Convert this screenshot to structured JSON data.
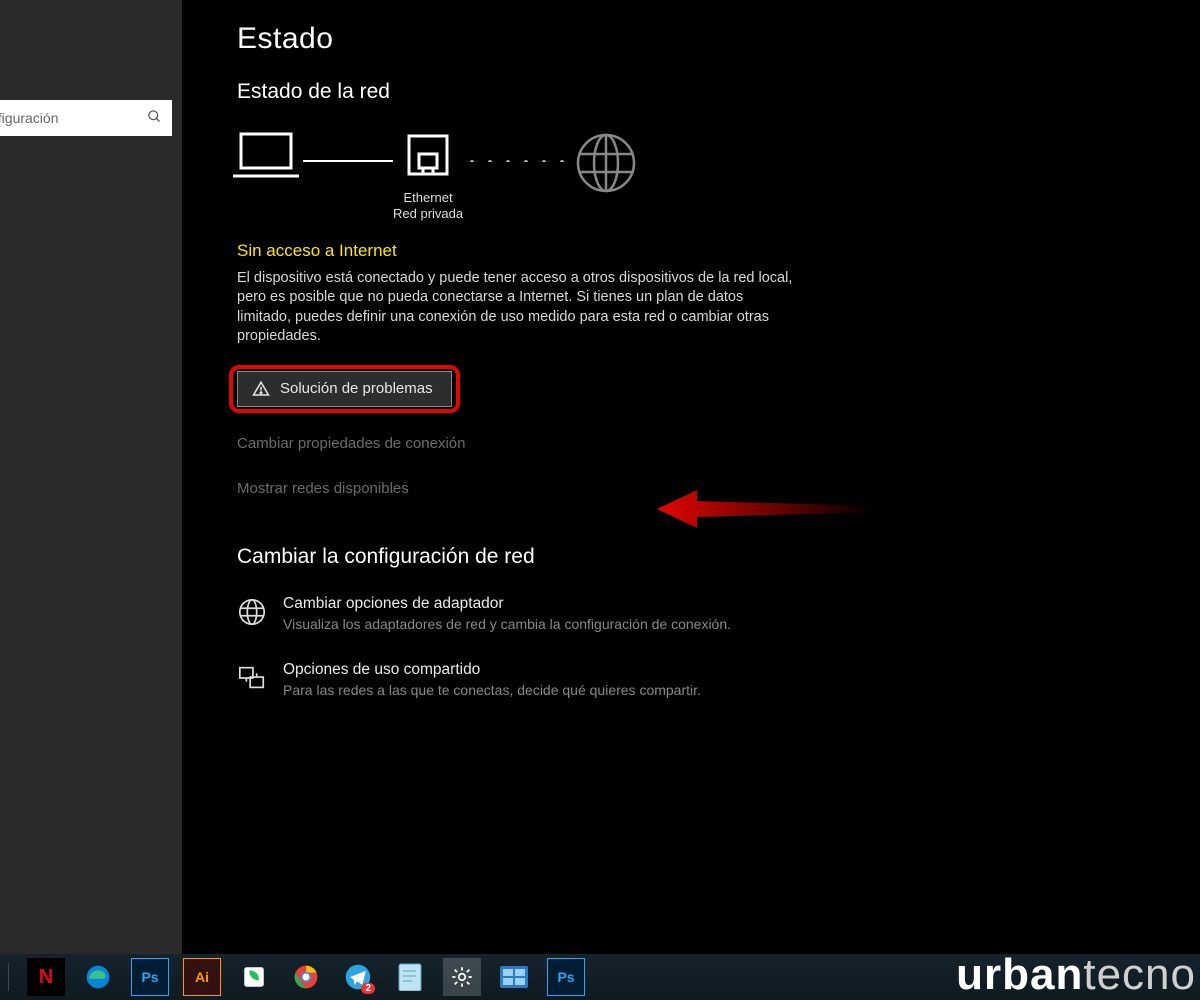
{
  "search": {
    "placeholder": "nfiguración"
  },
  "page": {
    "title": "Estado",
    "network_status_heading": "Estado de la red",
    "ethernet_label": "Ethernet",
    "ethernet_sub": "Red privada",
    "warn_title": "Sin acceso a Internet",
    "warn_text": "El dispositivo está conectado y puede tener acceso a otros dispositivos de la red local, pero es posible que no pueda conectarse a Internet. Si tienes un plan de datos limitado, puedes definir una conexión de uso medido para esta red o cambiar otras propiedades.",
    "troubleshoot_btn": "Solución de problemas",
    "link_change_props": "Cambiar propiedades de conexión",
    "link_show_networks": "Mostrar redes disponibles",
    "change_settings_heading": "Cambiar la configuración de red",
    "options": [
      {
        "title": "Cambiar opciones de adaptador",
        "desc": "Visualiza los adaptadores de red y cambia la configuración de conexión."
      },
      {
        "title": "Opciones de uso compartido",
        "desc": "Para las redes a las que te conectas, decide qué quieres compartir."
      }
    ]
  },
  "taskbar": {
    "icons": [
      "netflix",
      "edge",
      "photoshop",
      "illustrator",
      "evernote",
      "chrome",
      "telegram",
      "notepad",
      "settings",
      "control-panel",
      "photoshop"
    ]
  },
  "watermark": {
    "bold": "urban",
    "light": "tecno"
  }
}
